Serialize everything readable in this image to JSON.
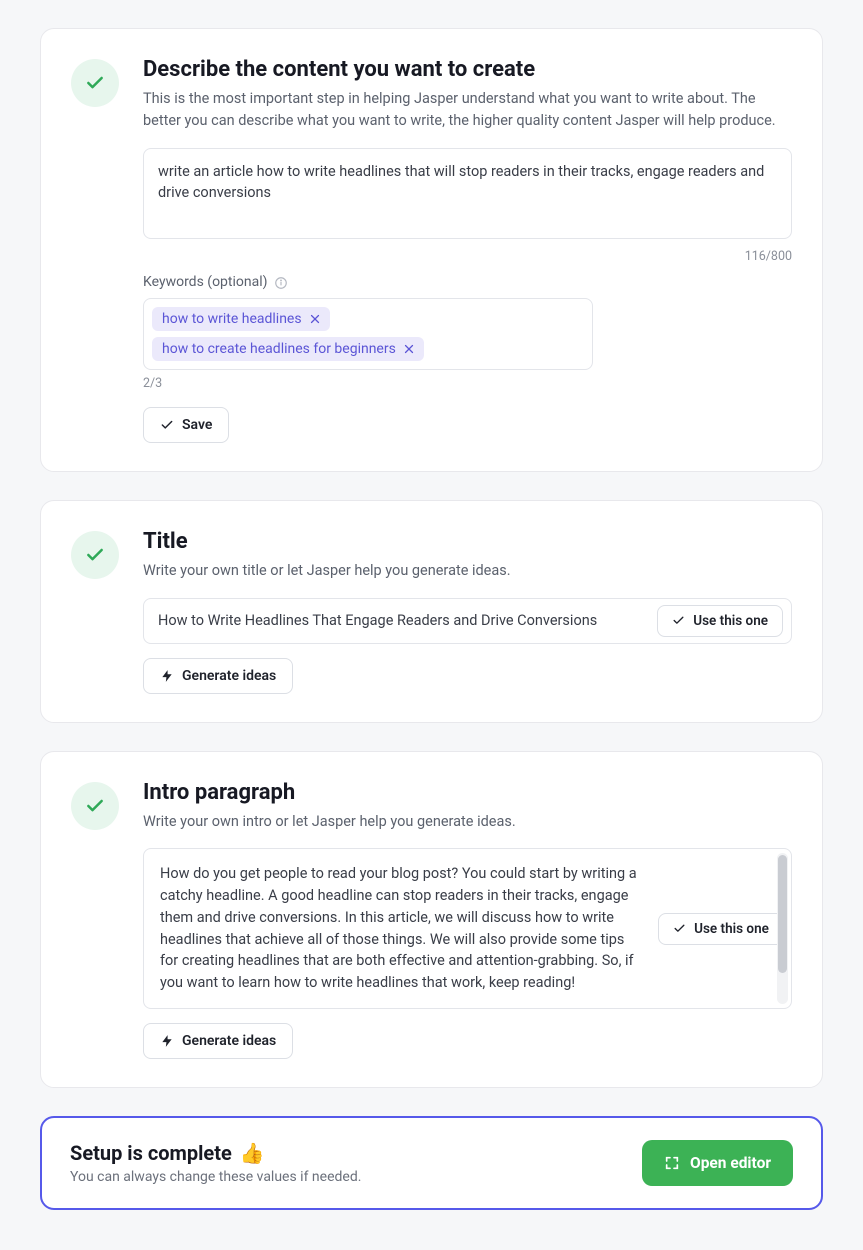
{
  "describe": {
    "title": "Describe the content you want to create",
    "desc": "This is the most important step in helping Jasper understand what you want to write about. The better you can describe what you want to write, the higher quality content Jasper will help produce.",
    "value": "write an article how to write headlines that will stop readers in their tracks, engage readers and drive conversions",
    "counter": "116/800",
    "keywords_label": "Keywords (optional)",
    "keywords": [
      "how to write headlines",
      "how to create headlines for beginners"
    ],
    "keywords_counter": "2/3",
    "save_label": "Save"
  },
  "title": {
    "title": "Title",
    "desc": "Write your own title or let Jasper help you generate ideas.",
    "value": "How to Write Headlines That Engage Readers and Drive Conversions",
    "use_label": "Use this one",
    "generate_label": "Generate ideas"
  },
  "intro": {
    "title": "Intro paragraph",
    "desc": "Write your own intro or let Jasper help you generate ideas.",
    "value": "How do you get people to read your blog post? You could start by writing a catchy headline. A good headline can stop readers in their tracks, engage them and drive conversions. In this article, we will discuss how to write headlines that achieve all of those things. We will also provide some tips for creating headlines that are both effective and attention-grabbing. So, if you want to learn how to write headlines that work, keep reading!",
    "use_label": "Use this one",
    "generate_label": "Generate ideas"
  },
  "complete": {
    "title": "Setup is complete",
    "emoji": "👍",
    "desc": "You can always change these values if needed.",
    "open_label": "Open editor"
  }
}
